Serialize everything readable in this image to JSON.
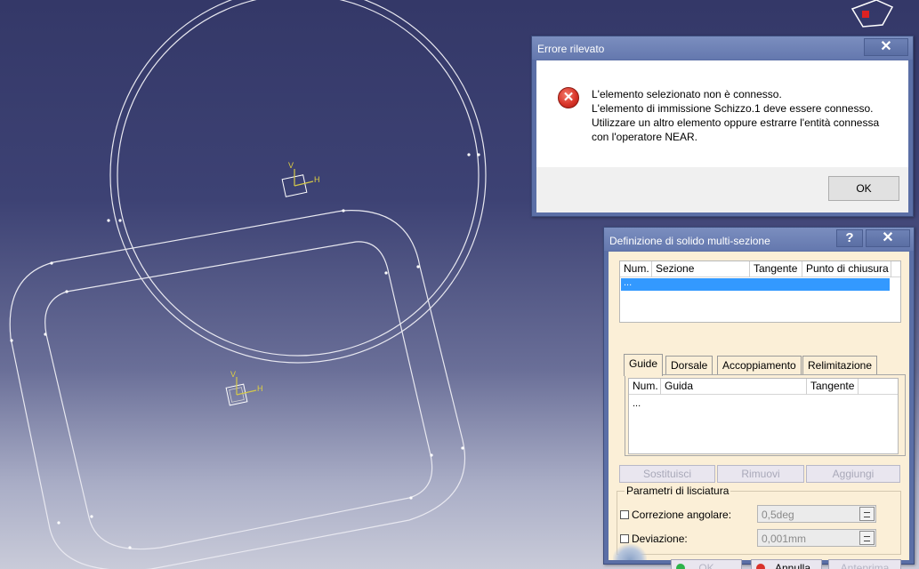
{
  "viewport": {
    "axis1": {
      "v_label": "V",
      "h_label": "H"
    },
    "axis2": {
      "v_label": "V",
      "h_label": "H"
    }
  },
  "error_dialog": {
    "title": "Errore rilevato",
    "close": "✕",
    "icon": "error-icon",
    "lines": [
      "L'elemento selezionato non è connesso.",
      "L'elemento di immissione Schizzo.1 deve essere connesso.",
      "Utilizzare un altro elemento oppure estrarre l'entità connessa",
      "con l'operatore NEAR."
    ],
    "ok_label": "OK"
  },
  "ms_dialog": {
    "title": "Definizione di solido multi-sezione",
    "help": "?",
    "close": "✕",
    "section_table": {
      "columns": [
        "Num.",
        "Sezione",
        "Tangente",
        "Punto di chiusura"
      ],
      "selected_row": "..."
    },
    "tabs": [
      "Guide",
      "Dorsale",
      "Accoppiamento",
      "Relimitazione"
    ],
    "active_tab": "Guide",
    "guide_table": {
      "columns": [
        "Num.",
        "Guida",
        "Tangente"
      ],
      "row": "..."
    },
    "buttons": {
      "replace": "Sostituisci",
      "remove": "Rimuovi",
      "add": "Aggiungi"
    },
    "smoothing": {
      "title": "Parametri di lisciatura",
      "angular_label": "Correzione angolare:",
      "angular_value": "0,5deg",
      "angular_checked": false,
      "deviation_label": "Deviazione:",
      "deviation_value": "0,001mm",
      "deviation_checked": false
    },
    "footer": {
      "ok": "OK",
      "cancel": "Annulla",
      "preview": "Anteprima"
    },
    "colors": {
      "ok_dot": "#2db34a",
      "cancel_dot": "#d9322b",
      "panel_bg": "#fbefd7",
      "selection": "#3399ff"
    }
  }
}
